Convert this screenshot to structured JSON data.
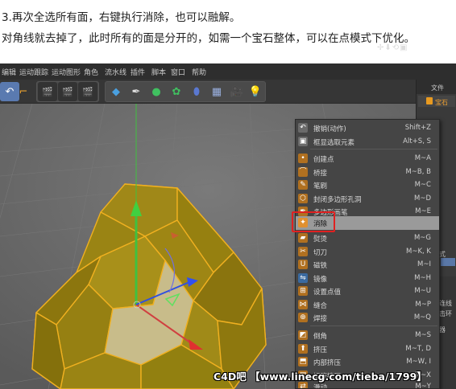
{
  "captions": {
    "line1": "3.再次全选所有面，右键执行消除，也可以融解。",
    "line2": "对角线就去掉了，此时所有的面是分开的，如需一个宝石整体，可以在点模式下优化。"
  },
  "menubar": [
    "编辑",
    "运动跟踪",
    "运动图形",
    "角色",
    "流水线",
    "插件",
    "脚本",
    "窗口",
    "帮助"
  ],
  "toolbar_icons": [
    "undo-icon",
    "coordinate-icon",
    "render-view-icon",
    "render-settings-icon",
    "render-region-icon",
    "cube-icon",
    "pen-icon",
    "sphere-object-icon",
    "cloner-icon",
    "deformer-icon",
    "floor-icon",
    "camera-icon",
    "light-icon"
  ],
  "right_panel": {
    "file_label": "文件",
    "object_label": "宝石",
    "side_labels": [
      "式",
      "连线",
      "击环",
      "器"
    ]
  },
  "context_menu": {
    "items": [
      {
        "label": "撤销(动作)",
        "key": "Shift+Z",
        "icon": "undo-icon",
        "color": "#6a6a6a"
      },
      {
        "label": "框显选取元素",
        "key": "Alt+S, S",
        "icon": "frame-selection-icon",
        "color": "#6a6a6a"
      },
      {
        "label": "创建点",
        "key": "M~A",
        "icon": "create-point-icon",
        "color": "#b07020"
      },
      {
        "label": "桥接",
        "key": "M~B, B",
        "icon": "bridge-icon",
        "color": "#b07020"
      },
      {
        "label": "笔刷",
        "key": "M~C",
        "icon": "brush-icon",
        "color": "#b07020"
      },
      {
        "label": "封闭多边形孔洞",
        "key": "M~D",
        "icon": "close-polygon-hole-icon",
        "color": "#b07020"
      },
      {
        "label": "多边形画笔",
        "key": "M~E",
        "icon": "polygon-pen-icon",
        "color": "#b07020"
      },
      {
        "label": "消除",
        "key": "",
        "icon": "dissolve-icon",
        "color": "#e09030"
      },
      {
        "label": "熨烫",
        "key": "M~G",
        "icon": "iron-icon",
        "color": "#b07020"
      },
      {
        "label": "切刀",
        "key": "M~K, K",
        "icon": "knife-icon",
        "color": "#b07020"
      },
      {
        "label": "磁铁",
        "key": "M~I",
        "icon": "magnet-icon",
        "color": "#b07020"
      },
      {
        "label": "镜像",
        "key": "M~H",
        "icon": "mirror-icon",
        "color": "#3a6aa0"
      },
      {
        "label": "设置点值",
        "key": "M~U",
        "icon": "set-point-value-icon",
        "color": "#b07020"
      },
      {
        "label": "缝合",
        "key": "M~P",
        "icon": "stitch-icon",
        "color": "#b07020"
      },
      {
        "label": "焊接",
        "key": "M~Q",
        "icon": "weld-icon",
        "color": "#b07020"
      },
      {
        "label": "倒角",
        "key": "M~S",
        "icon": "bevel-icon",
        "color": "#b07020"
      },
      {
        "label": "挤压",
        "key": "M~T, D",
        "icon": "extrude-icon",
        "color": "#b07020"
      },
      {
        "label": "内部挤压",
        "key": "M~W, I",
        "icon": "extrude-inner-icon",
        "color": "#b07020"
      },
      {
        "label": "矩阵挤压",
        "key": "M~X",
        "icon": "matrix-extrude-icon",
        "color": "#b07020"
      },
      {
        "label": "滑动",
        "key": "M~Y",
        "icon": "slide-icon",
        "color": "#b07020"
      }
    ]
  },
  "watermark": "C4D吧 【www.linecg.com/tieba/1799】",
  "colors": {
    "gem_face": "#9a8210",
    "gem_edge": "#f0b020",
    "highlight_box": "#e02020",
    "viewport_bg": "#686868"
  }
}
